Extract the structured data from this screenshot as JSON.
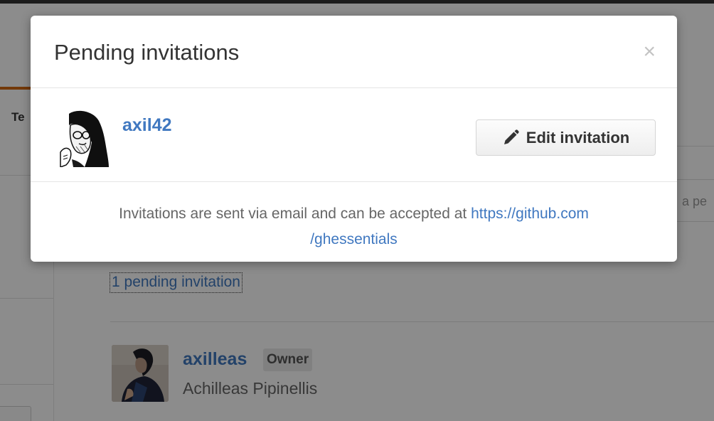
{
  "background": {
    "tab_label": "Te",
    "search_placeholder": "a pe",
    "pending_link": "1 pending invitation",
    "members": [
      {
        "login": "axilleas",
        "badge": "Owner",
        "name": "Achilleas Pipinellis",
        "avatar_icon": "member-avatar-photo"
      }
    ]
  },
  "modal": {
    "title": "Pending invitations",
    "close_glyph": "×",
    "close_icon": "close-icon",
    "invitation": {
      "login": "axil42",
      "avatar_icon": "caricature-avatar",
      "edit_label": "Edit invitation",
      "edit_icon": "pencil-icon"
    },
    "footer": {
      "text": "Invitations are sent via email and can be accepted at",
      "link_part1": "https://github.com",
      "link_part2": "/ghessentials"
    }
  },
  "colors": {
    "link": "#4078c0",
    "overlay": "rgba(0,0,0,0.45)",
    "tab_accent": "#d26911"
  }
}
